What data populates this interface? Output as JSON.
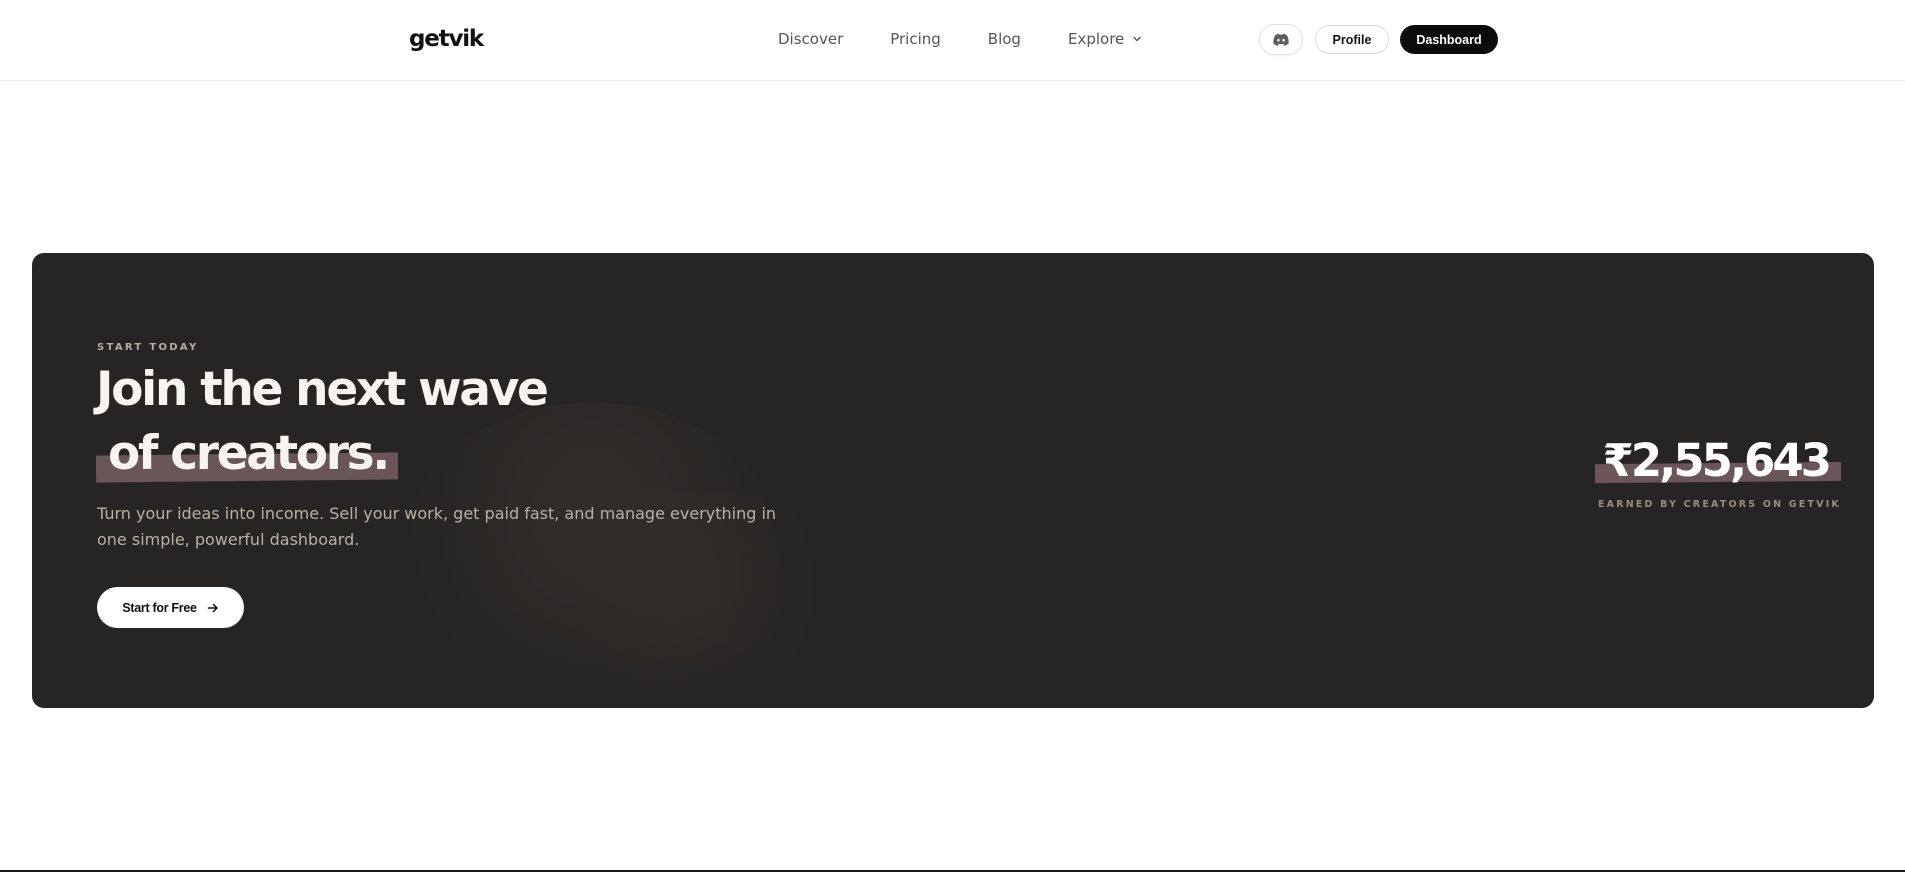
{
  "header": {
    "logo": "getvik",
    "nav": [
      {
        "label": "Discover"
      },
      {
        "label": "Pricing"
      },
      {
        "label": "Blog"
      },
      {
        "label": "Explore",
        "icon": "chevron-down-icon"
      }
    ],
    "discord_icon": "discord-icon",
    "profile_label": "Profile",
    "dashboard_label": "Dashboard"
  },
  "hero": {
    "eyebrow": "START TODAY",
    "headline_line1": "Join the next wave",
    "headline_line2": "of creators.",
    "subcopy": "Turn your ideas into income. Sell your work, get paid fast, and manage everything in one simple, powerful dashboard.",
    "cta_label": "Start for Free",
    "cta_icon": "arrow-right-icon",
    "stat_value": "₹2,55,643",
    "stat_caption": "EARNED BY CREATORS ON GETVIK"
  },
  "colors": {
    "hero_background": "#262523",
    "highlight": "#6a5558",
    "primary_button": "#0b0b0b"
  }
}
